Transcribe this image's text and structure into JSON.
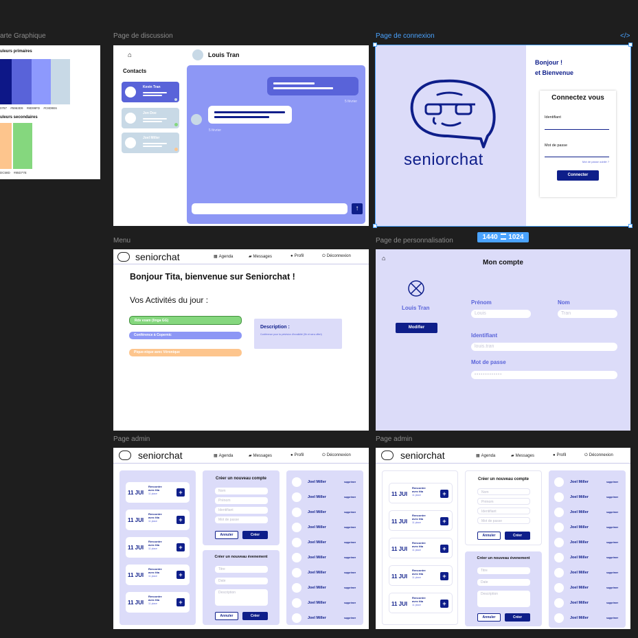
{
  "labels": {
    "charte": "arte Graphique",
    "discussion": "Page de discussion",
    "connexion": "Page de connexion",
    "code_icon": "</>",
    "menu": "Menu",
    "perso": "Page de personnalisation",
    "size_w": "1440",
    "size_h": "1024",
    "admin1": "Page admin",
    "admin2": "Page admin"
  },
  "charte": {
    "primary_title": "uleurs primaires",
    "secondary_title": "uleurs secondaires",
    "primary_colors": [
      "#0D1787",
      "#5963D9",
      "#8D99FD",
      "#C8D9E6"
    ],
    "primary_codes": [
      "0787",
      "#5963D9",
      "#8D99FD",
      "#C8D9E6"
    ],
    "secondary_colors": [
      "#FDC58D",
      "#85D77E"
    ],
    "secondary_codes": [
      "DC58D",
      "#85D77E"
    ]
  },
  "discussion": {
    "home_icon": "home-icon",
    "contact_name": "Louis Tran",
    "contacts_title": "Contacts",
    "contacts": [
      "Kevin Tran",
      "Jon Doe",
      "Joel Miller"
    ],
    "date1": "5 février",
    "date2": "5 février",
    "send_icon": "arrow-up-icon"
  },
  "connexion": {
    "brand": "seniorchat",
    "greeting1": "Bonjour !",
    "greeting2": "et Bienvenue",
    "form_title": "Connectez vous",
    "id_label": "Identifiant",
    "pw_label": "Mot de passe",
    "forgot": "Mot de passe oublié ?",
    "submit": "Connecter"
  },
  "nav": {
    "brand": "seniorchat",
    "agenda": "Agenda",
    "messages": "Messages",
    "profil": "Profil",
    "deconnexion": "Déconnexion"
  },
  "menu": {
    "welcome": "Bonjour Tita, bienvenue sur Seniorchat !",
    "activities_title": "Vos Activités du jour :",
    "activities": [
      "Rdv exam (linga GG)",
      "Conférence à Copernic",
      "Pique-nique avec Véronique"
    ],
    "desc_title": "Description :",
    "desc_text": "Conférence pour la prévision d'invalidité (5h et sera offert)"
  },
  "perso": {
    "page_title": "Mon compte",
    "name": "Louis Tran",
    "modify": "Modifier",
    "prenom_label": "Prénom",
    "prenom_value": "Louis",
    "nom_label": "Nom",
    "nom_value": "Tran",
    "id_label": "Identifiant",
    "id_value": "louis.tran",
    "pw_label": "Mot de passe",
    "pw_value": "•••••••••••••"
  },
  "admin": {
    "event_day": "11 JUI",
    "event_title1": "Rencontre",
    "event_title2": "avec tita",
    "event_places": "11 place",
    "create_account_title": "Créer un nouveau compte",
    "account_fields": [
      "Nom",
      "Prénom",
      "Identifiant",
      "Mot de passe"
    ],
    "create_event_title": "Créer un nouveau évenement",
    "event_fields": [
      "Titre",
      "Date",
      "Description"
    ],
    "cancel": "Annuler",
    "create": "Créer",
    "user_name": "Joel Miller",
    "delete": "supprimer"
  },
  "colors": {
    "navy": "#0e1e8a",
    "lavender": "#dcdcf9",
    "periwinkle": "#8d97f5",
    "pale": "#c8d9e6",
    "green": "#85d77e",
    "orange": "#fdc58d",
    "selection": "#4aa3ff"
  }
}
